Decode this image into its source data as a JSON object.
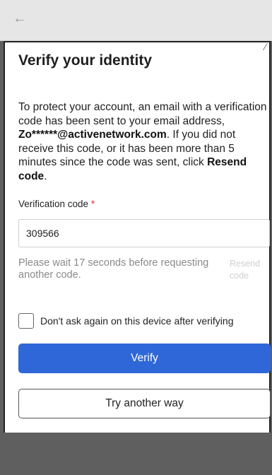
{
  "header": {
    "back_icon": "arrow-left-icon",
    "back_glyph": "←"
  },
  "page": {
    "title": "Verify your identity",
    "description": {
      "part1": "To protect your account, an email with a verification code has been sent to your email address, ",
      "email": "Zo******@activenetwork.com",
      "part2": ". If you did not receive this code, or it has been more than 5 minutes since the code was sent, click ",
      "resend_bold": "Resend code",
      "part3": "."
    }
  },
  "form": {
    "code_label": "Verification code",
    "required_marker": "*",
    "code_value": "309566",
    "wait_text": "Please wait  17  seconds before requesting another code.",
    "resend_label": "Resend code",
    "remember_label": "Don't ask again on this device after verifying",
    "remember_checked": false
  },
  "actions": {
    "verify_label": "Verify",
    "another_way_label": "Try another way"
  },
  "colors": {
    "primary": "#2f67d8",
    "required": "#d93025",
    "muted_text": "#8a8a8a",
    "disabled_link": "#cfcfcf"
  }
}
